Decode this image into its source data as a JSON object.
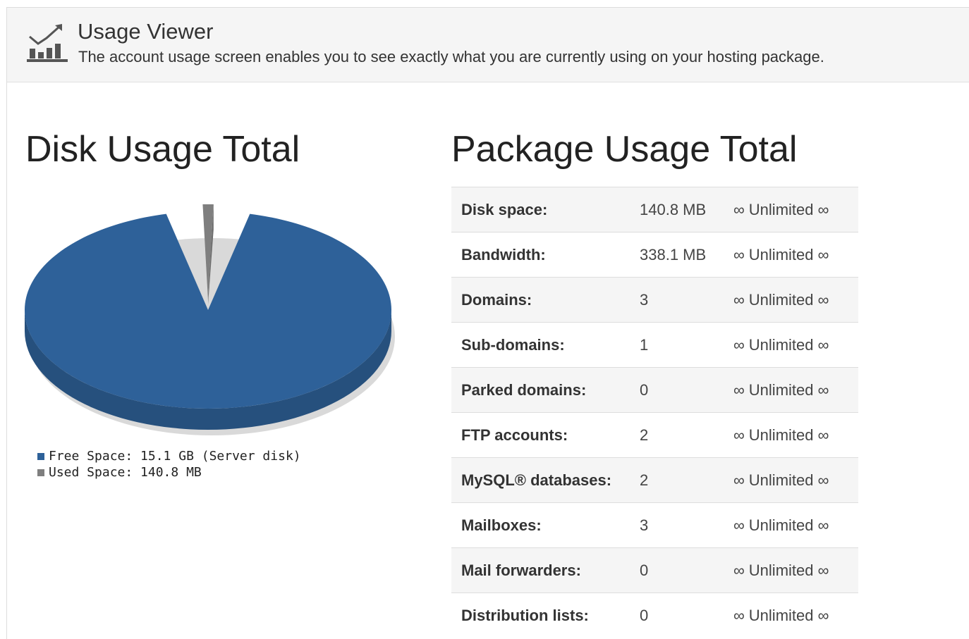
{
  "header": {
    "icon": "chart-trend-icon",
    "title": "Usage Viewer",
    "description": "The account usage screen enables you to see exactly what you are currently using on your hosting package."
  },
  "disk": {
    "title": "Disk Usage Total",
    "legend": [
      {
        "label": "Free Space: 15.1 GB (Server disk)",
        "color": "#2e6199"
      },
      {
        "label": "Used Space: 140.8 MB",
        "color": "#7f7f7f"
      }
    ]
  },
  "package": {
    "title": "Package Usage Total",
    "rows": [
      {
        "label": "Disk space:",
        "value": "140.8 MB",
        "limit": "∞ Unlimited ∞"
      },
      {
        "label": "Bandwidth:",
        "value": "338.1 MB",
        "limit": "∞ Unlimited ∞"
      },
      {
        "label": "Domains:",
        "value": "3",
        "limit": "∞ Unlimited ∞"
      },
      {
        "label": "Sub-domains:",
        "value": "1",
        "limit": "∞ Unlimited ∞"
      },
      {
        "label": "Parked domains:",
        "value": "0",
        "limit": "∞ Unlimited ∞"
      },
      {
        "label": "FTP accounts:",
        "value": "2",
        "limit": "∞ Unlimited ∞"
      },
      {
        "label": "MySQL® databases:",
        "value": "2",
        "limit": "∞ Unlimited ∞"
      },
      {
        "label": "Mailboxes:",
        "value": "3",
        "limit": "∞ Unlimited ∞"
      },
      {
        "label": "Mail forwarders:",
        "value": "0",
        "limit": "∞ Unlimited ∞"
      },
      {
        "label": "Distribution lists:",
        "value": "0",
        "limit": "∞ Unlimited ∞"
      }
    ]
  },
  "chart_data": {
    "type": "pie",
    "title": "",
    "slices": [
      {
        "name": "Free Space",
        "value_gb": 15.1,
        "color": "#2e6199"
      },
      {
        "name": "Used Space",
        "value_gb": 0.1375,
        "color": "#7f7f7f"
      }
    ]
  }
}
